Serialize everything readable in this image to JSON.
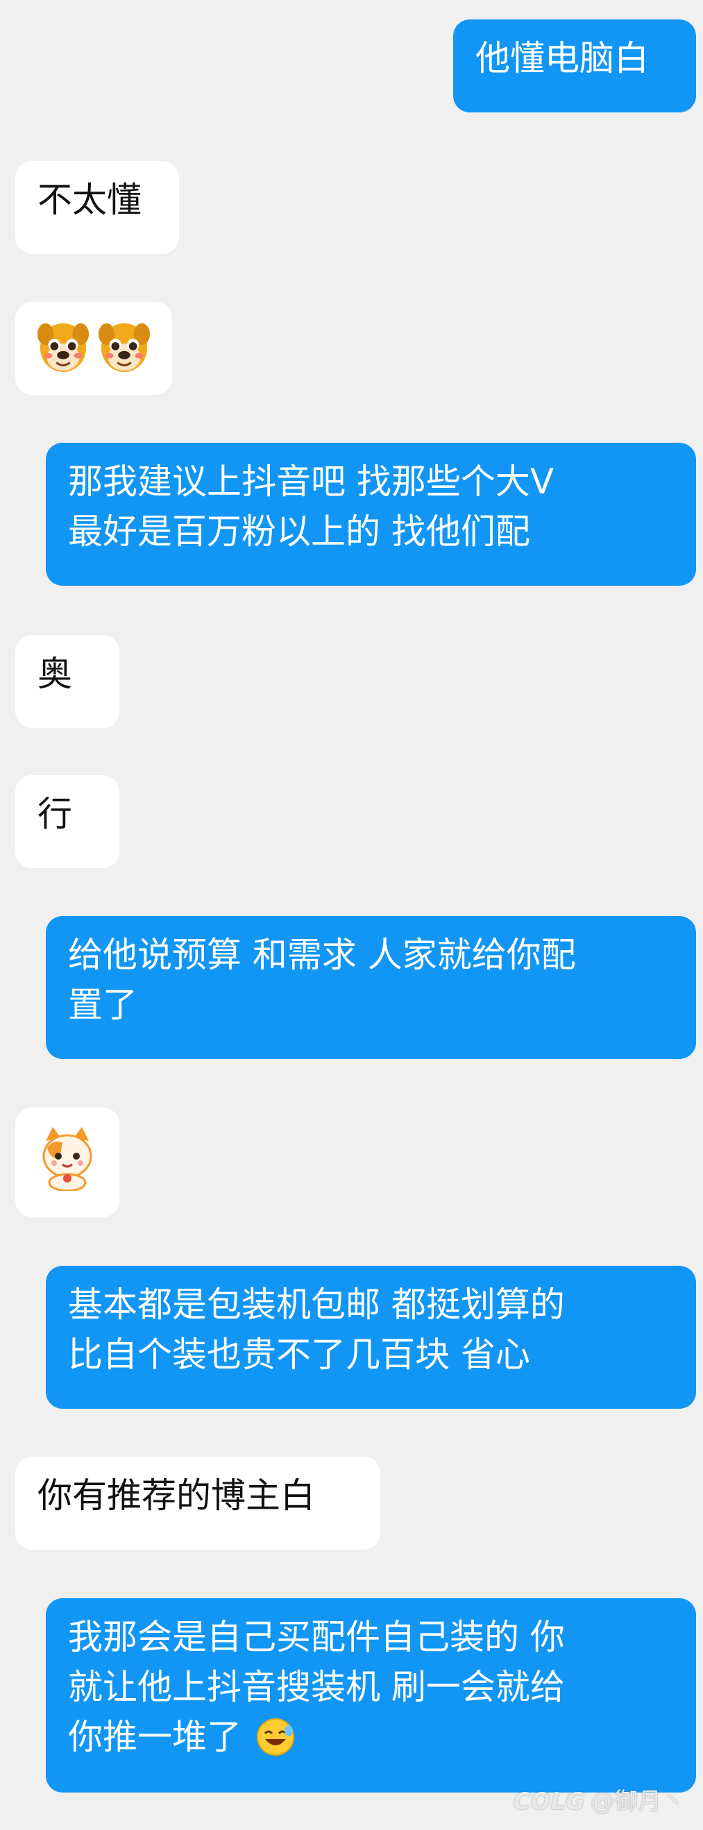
{
  "messages": [
    {
      "side": "out",
      "lines": [
        "他懂电脑白"
      ]
    },
    {
      "side": "in",
      "lines": [
        "不太懂"
      ]
    },
    {
      "side": "in",
      "emoji": [
        "dog-face-emoji",
        "dog-face-emoji"
      ]
    },
    {
      "side": "out",
      "lines": [
        "那我建议上抖音吧 找那些个大V",
        "最好是百万粉以上的 找他们配"
      ]
    },
    {
      "side": "in",
      "lines": [
        "奥"
      ]
    },
    {
      "side": "in",
      "lines": [
        "行"
      ]
    },
    {
      "side": "out",
      "lines": [
        "给他说预算 和需求 人家就给你配",
        "置了"
      ]
    },
    {
      "side": "in",
      "emoji": [
        "lucky-cat-emoji"
      ]
    },
    {
      "side": "out",
      "lines": [
        "基本都是包装机包邮  都挺划算的",
        "比自个装也贵不了几百块 省心"
      ]
    },
    {
      "side": "in",
      "lines": [
        "你有推荐的博主白"
      ]
    },
    {
      "side": "out",
      "lines": [
        "我那会是自己买配件自己装的  你",
        "就让他上抖音搜装机 刷一会就给",
        "你推一堆了"
      ],
      "trailing_emoji": "laughing-face-emoji"
    }
  ],
  "watermark": {
    "logo": "COLG",
    "user": "@御月丶"
  },
  "colors": {
    "outgoing_bubble": "#1196f5",
    "incoming_bubble": "#ffffff",
    "background": "#f0f0f0"
  }
}
